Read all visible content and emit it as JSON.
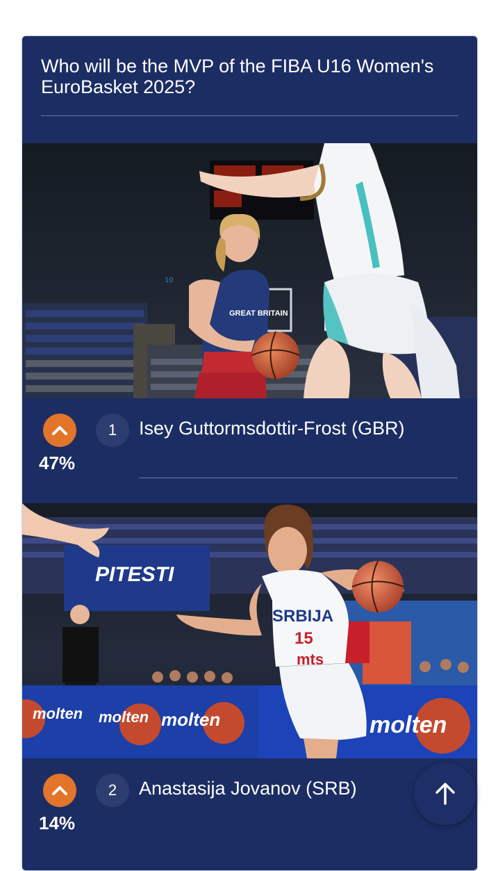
{
  "poll": {
    "question": "Who will be the MVP of the FIBA U16 Women's EuroBasket 2025?"
  },
  "options": [
    {
      "rank": "1",
      "name": "Isey Guttormsdottir-Frost (GBR)",
      "percent": "47%",
      "photo_scoreboard_text": "10",
      "jersey_text": "GREAT BRITAIN"
    },
    {
      "rank": "2",
      "name": "Anastasija Jovanov (SRB)",
      "percent": "14%",
      "arena_banner_text": "PITESTI",
      "jersey_text": "SRBIJA",
      "jersey_number": "15",
      "sponsor_text": "mts",
      "board_text": "molten"
    }
  ],
  "icons": {
    "vote": "chevron-up-icon",
    "scroll": "arrow-up-icon"
  },
  "colors": {
    "card_bg": "#1b2d63",
    "vote_button": "#e2752a",
    "rank_badge": "#2d3d70"
  }
}
